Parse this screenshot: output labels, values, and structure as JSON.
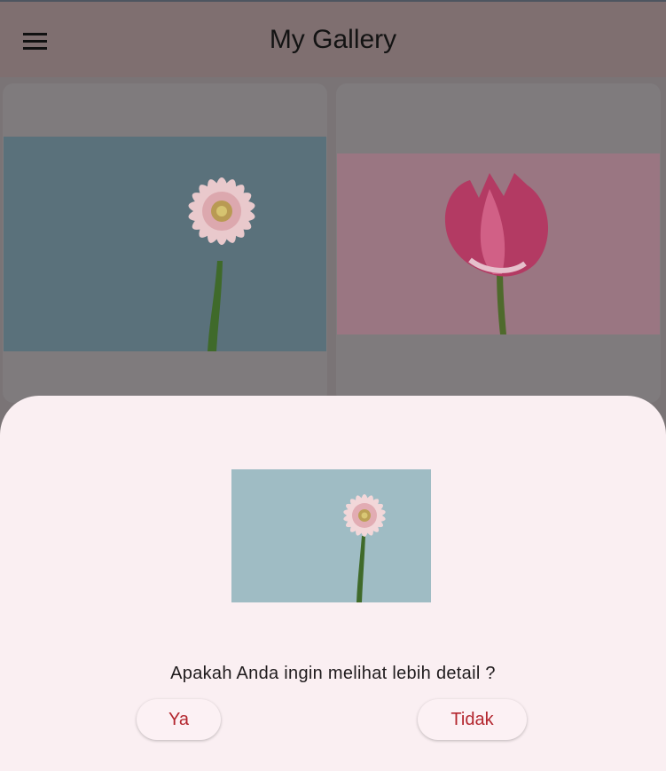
{
  "app_bar": {
    "title": "My Gallery",
    "menu_icon": "hamburger-menu-icon"
  },
  "gallery": {
    "items": [
      {
        "subject": "pink gerbera daisy"
      },
      {
        "subject": "pink tulip"
      }
    ]
  },
  "dialog": {
    "question": "Apakah Anda ingin melihat lebih detail ?",
    "yes_label": "Ya",
    "no_label": "Tidak"
  },
  "colors": {
    "accent": "#b3262e",
    "dialog_background": "#faeff2",
    "app_bar": "#7f6f70"
  }
}
